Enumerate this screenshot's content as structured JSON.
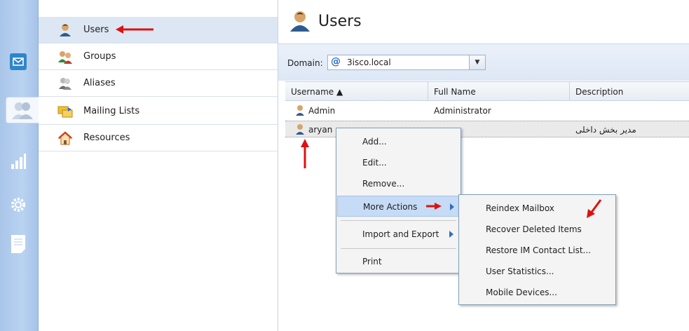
{
  "nav": {
    "items": [
      {
        "label": "Users",
        "icon": "user-icon"
      },
      {
        "label": "Groups",
        "icon": "group-icon"
      },
      {
        "label": "Aliases",
        "icon": "alias-icon"
      },
      {
        "label": "Mailing Lists",
        "icon": "mailing-list-icon"
      },
      {
        "label": "Resources",
        "icon": "home-icon"
      }
    ],
    "selected": "Users"
  },
  "rail": {
    "icons": [
      "mail-icon",
      "users-icon",
      "reports-icon",
      "settings-icon",
      "notes-icon"
    ],
    "active": "users-icon"
  },
  "main": {
    "title": "Users",
    "domain_label": "Domain:",
    "domain_value": "3isco.local",
    "columns": [
      "Username ▲",
      "Full Name",
      "Description"
    ],
    "rows": [
      {
        "username": "Admin",
        "full_name": "Administrator",
        "description": ""
      },
      {
        "username": "aryan",
        "full_name": "",
        "description": "مدیر بخش داخلی"
      }
    ]
  },
  "context_menu": {
    "items": [
      "Add...",
      "Edit...",
      "Remove...",
      "More Actions",
      "Import and Export",
      "Print"
    ]
  },
  "submenu": {
    "items": [
      "Reindex Mailbox",
      "Recover Deleted Items",
      "Restore IM Contact List...",
      "User Statistics...",
      "Mobile Devices..."
    ]
  },
  "colors": {
    "rail": "#b3cdee",
    "selection": "#dde7f4",
    "menu_hover": "#c6dbf5",
    "annotation": "#e01010"
  }
}
